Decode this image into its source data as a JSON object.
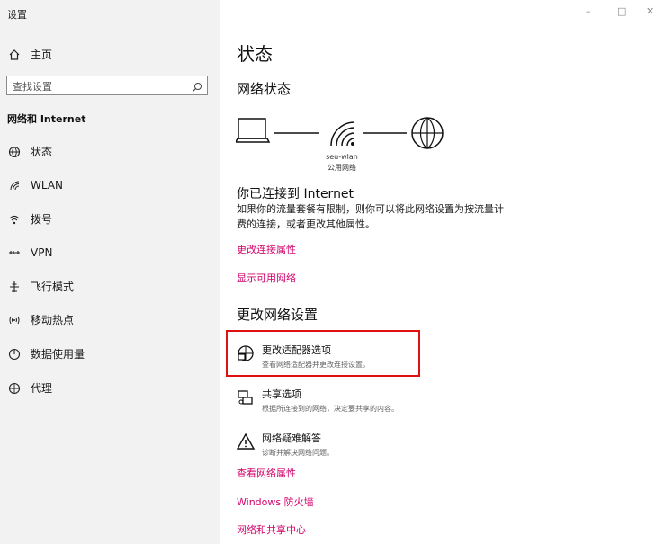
{
  "window": {
    "title": "设置",
    "minimize": "–",
    "maximize": "□",
    "close": "✕"
  },
  "sidebar": {
    "home": "主页",
    "search_placeholder": "查找设置",
    "section": "网络和 Internet",
    "items": [
      {
        "label": "状态",
        "icon": "status-globe-icon"
      },
      {
        "label": "WLAN",
        "icon": "wifi-icon"
      },
      {
        "label": "拨号",
        "icon": "dialup-icon"
      },
      {
        "label": "VPN",
        "icon": "vpn-icon"
      },
      {
        "label": "飞行模式",
        "icon": "airplane-icon"
      },
      {
        "label": "移动热点",
        "icon": "hotspot-icon"
      },
      {
        "label": "数据使用量",
        "icon": "data-usage-icon"
      },
      {
        "label": "代理",
        "icon": "proxy-globe-icon"
      }
    ]
  },
  "main": {
    "title": "状态",
    "network_status_heading": "网络状态",
    "network": {
      "ssid": "seu-wlan",
      "type": "公用网络"
    },
    "connected_heading": "你已连接到 Internet",
    "connected_desc_line1": "如果你的流量套餐有限制，则你可以将此网络设置为按流量计",
    "connected_desc_line2": "费的连接，或者更改其他属性。",
    "link_change_props": "更改连接属性",
    "link_show_networks": "显示可用网络",
    "change_settings_heading": "更改网络设置",
    "options": [
      {
        "title": "更改适配器选项",
        "desc": "查看网络适配器并更改连接设置。",
        "icon": "adapter-icon"
      },
      {
        "title": "共享选项",
        "desc": "根据所连接到的网络，决定要共享的内容。",
        "icon": "sharing-icon"
      },
      {
        "title": "网络疑难解答",
        "desc": "诊断并解决网络问题。",
        "icon": "warning-icon"
      }
    ],
    "link_view_props": "查看网络属性",
    "link_firewall": "Windows 防火墙",
    "link_sharing_center": "网络和共享中心"
  },
  "colors": {
    "link": "#d1006a",
    "highlight_box": "#e01010",
    "sidebar_bg": "#f2f2f2"
  }
}
